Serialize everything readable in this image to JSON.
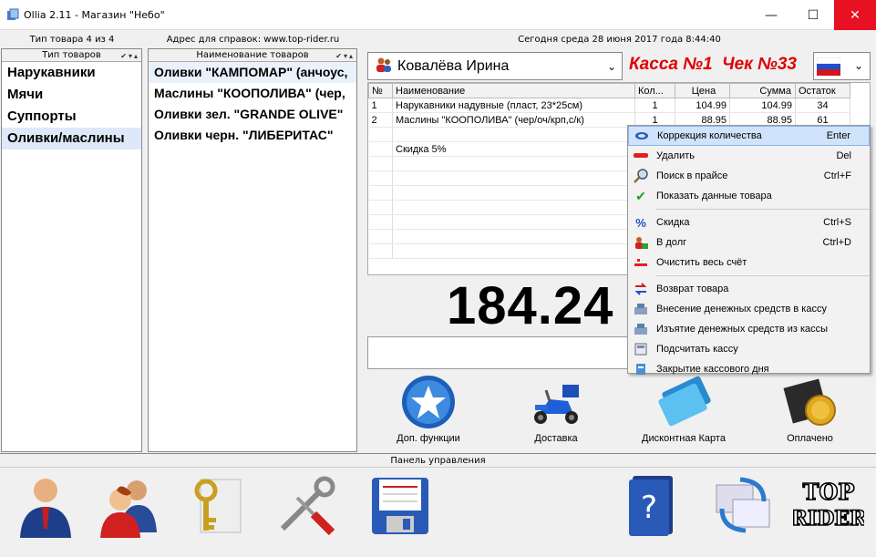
{
  "window": {
    "title": "Ollia 2.11 - Магазин \"Небо\"",
    "minimize": "—",
    "maximize": "☐",
    "close": "✕"
  },
  "header": {
    "type_count": "Тип товара 4 из 4",
    "address": "Адрес для справок: www.top-rider.ru",
    "date": "Сегодня  среда  28 июня 2017 года  8:44:40"
  },
  "categories": {
    "header": "Тип товаров",
    "items": [
      "Нарукавники",
      "Мячи",
      "Суппорты",
      "Оливки/маслины"
    ]
  },
  "products": {
    "header": "Наименование товаров",
    "items": [
      "Оливки \"КАМПОМАР\" (анчоус,",
      "Маслины \"КООПОЛИВА\" (чер,",
      "Оливки зел. \"GRANDE OLIVE\"",
      "Оливки черн. \"ЛИБЕРИТАС\""
    ]
  },
  "customer": {
    "name": "Ковалёва Ирина",
    "kassa": "Касса №1",
    "check": "Чек №33"
  },
  "receipt": {
    "columns": [
      "№",
      "Наименование",
      "Кол...",
      "Цена",
      "Сумма",
      "Остаток"
    ],
    "rows": [
      [
        "1",
        "Нарукавники надувные (пласт, 23*25см)",
        "1",
        "104.99",
        "104.99",
        "34"
      ],
      [
        "2",
        "Маслины \"КООПОЛИВА\" (чер/оч/крп,с/к)",
        "1",
        "88.95",
        "88.95",
        "61"
      ]
    ],
    "discount": "Скидка  5%"
  },
  "total": "184.24",
  "context_menu": [
    {
      "label": "Коррекция количества",
      "shortcut": "Enter",
      "icon": "correction-icon"
    },
    {
      "label": "Удалить",
      "shortcut": "Del",
      "icon": "delete-icon"
    },
    {
      "label": "Поиск в прайсе",
      "shortcut": "Ctrl+F",
      "icon": "search-icon"
    },
    {
      "label": "Показать данные товара",
      "shortcut": "",
      "icon": "check-icon"
    },
    {
      "label": "Скидка",
      "shortcut": "Ctrl+S",
      "icon": "percent-icon"
    },
    {
      "label": "В долг",
      "shortcut": "Ctrl+D",
      "icon": "debt-icon"
    },
    {
      "label": "Очистить весь счёт",
      "shortcut": "",
      "icon": "clear-icon"
    },
    {
      "label": "Возврат товара",
      "shortcut": "",
      "icon": "return-icon"
    },
    {
      "label": "Внесение денежных средств в кассу",
      "shortcut": "",
      "icon": "cash-in-icon"
    },
    {
      "label": "Изъятие денежных средств из кассы",
      "shortcut": "",
      "icon": "cash-out-icon"
    },
    {
      "label": "Подсчитать кассу",
      "shortcut": "",
      "icon": "calc-icon"
    },
    {
      "label": "Закрытие кассового дня",
      "shortcut": "",
      "icon": "close-day-icon"
    }
  ],
  "actions": [
    {
      "label": "Доп. функции",
      "icon": "star-icon"
    },
    {
      "label": "Доставка",
      "icon": "scooter-icon"
    },
    {
      "label": "Дисконтная Карта",
      "icon": "card-icon"
    },
    {
      "label": "Оплачено",
      "icon": "paid-icon"
    }
  ],
  "panel": {
    "title": "Панель управления",
    "logo": "TOP RIDER"
  }
}
